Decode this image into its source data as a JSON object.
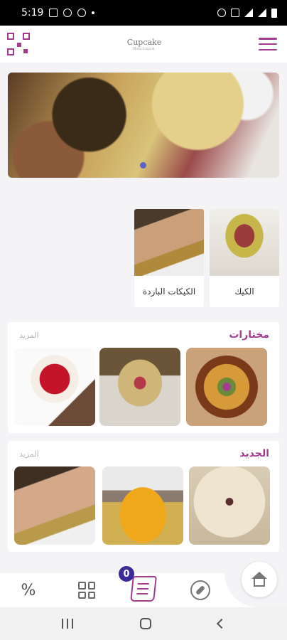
{
  "status_bar": {
    "time": "5:19"
  },
  "header": {
    "logo_brand": "Cupcake",
    "logo_sub": "Boutique"
  },
  "categories": [
    {
      "label": "الكيك"
    },
    {
      "label": "الكيكات الباردة"
    }
  ],
  "sections": {
    "featured": {
      "title": "مختارات",
      "more": "المزيد"
    },
    "new": {
      "title": "الجديد",
      "more": "المزيد"
    }
  },
  "cart": {
    "count": "0"
  },
  "colors": {
    "accent": "#a33d8f",
    "badge": "#3a2a9a"
  },
  "icons": [
    "qr-code-icon",
    "menu-icon",
    "percent-icon",
    "grid-icon",
    "cart-icon",
    "compass-icon",
    "home-icon"
  ]
}
